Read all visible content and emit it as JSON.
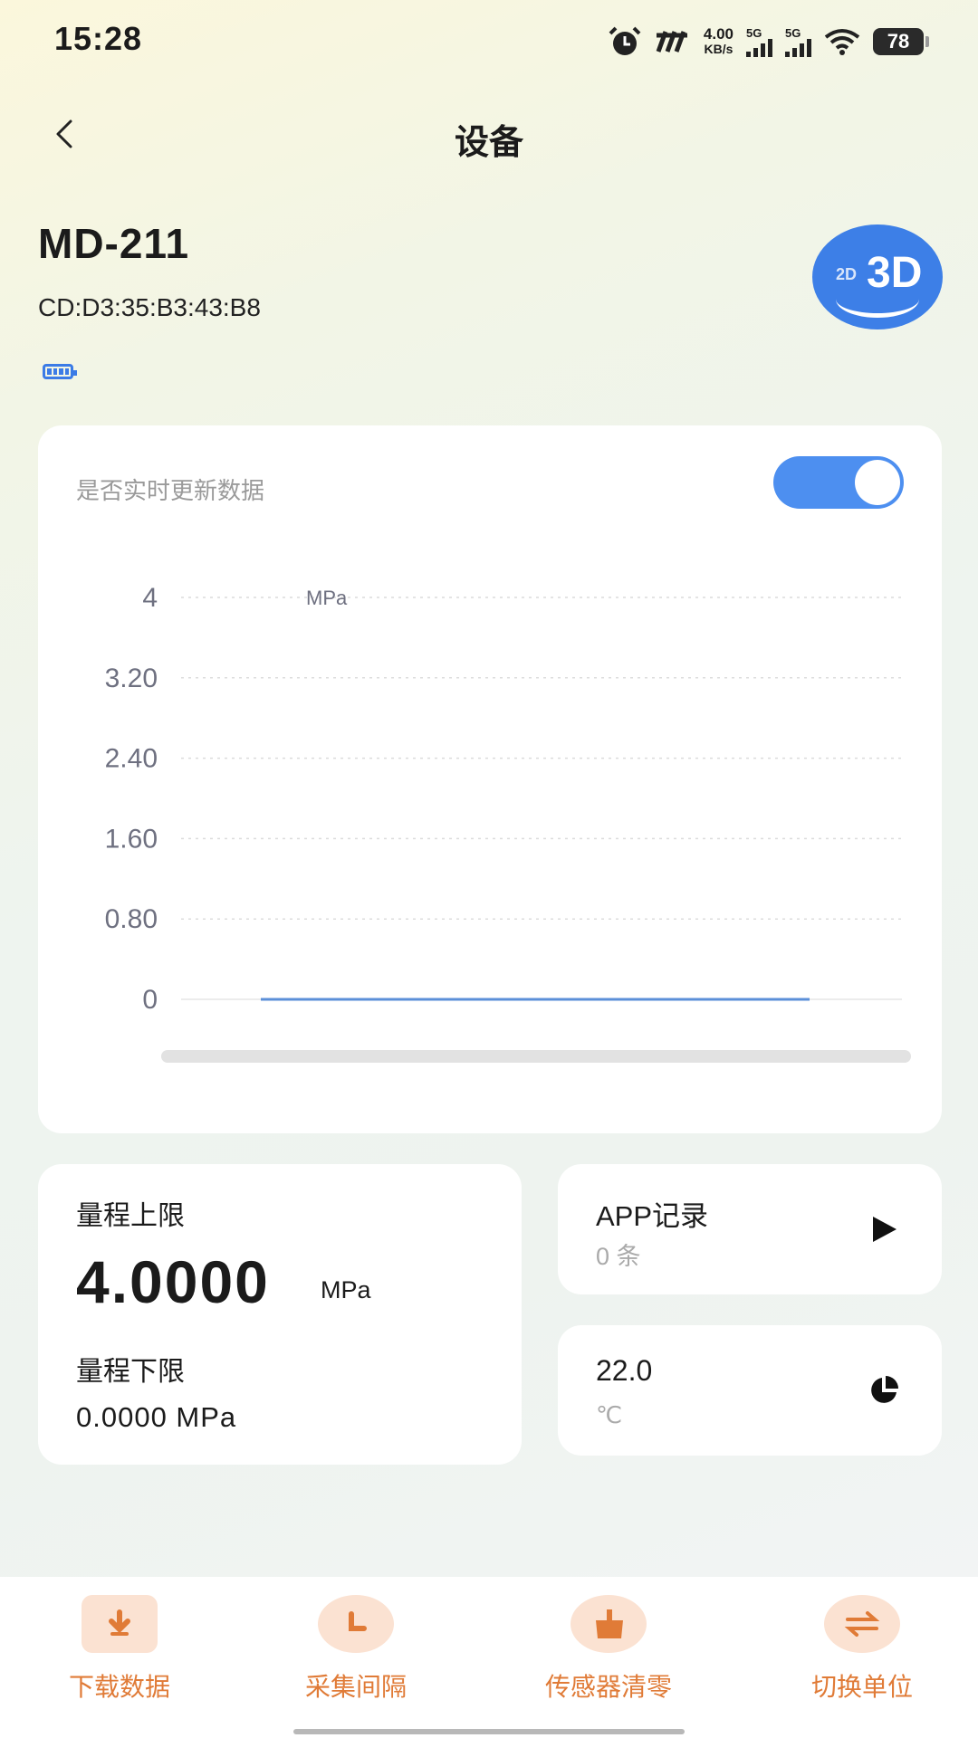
{
  "status_bar": {
    "time": "15:28",
    "speed_value": "4.00",
    "speed_unit": "KB/s",
    "sim1": "5G",
    "sim2": "5G",
    "battery": "78"
  },
  "header": {
    "title": "设备"
  },
  "device": {
    "name": "MD-211",
    "mac": "CD:D3:35:B3:43:B8",
    "view_toggle_2d": "2D",
    "view_toggle_3d": "3D"
  },
  "realtime": {
    "label": "是否实时更新数据",
    "enabled": true
  },
  "chart_data": {
    "type": "line",
    "unit_label": "MPa",
    "y_ticks": [
      "4",
      "3.20",
      "2.40",
      "1.60",
      "0.80",
      "0"
    ],
    "ylim": [
      0,
      4
    ],
    "grid": true,
    "series": [
      {
        "values": [
          0,
          0
        ]
      }
    ]
  },
  "range": {
    "upper_label": "量程上限",
    "upper_value": "4.0000",
    "upper_unit": "MPa",
    "lower_label": "量程下限",
    "lower_value": "0.0000 MPa"
  },
  "app_record": {
    "title": "APP记录",
    "count": "0 条"
  },
  "temperature": {
    "value": "22.0",
    "unit": "℃"
  },
  "bottom_nav": [
    {
      "label": "下载数据",
      "icon": "download-icon"
    },
    {
      "label": "采集间隔",
      "icon": "clock-icon"
    },
    {
      "label": "传感器清零",
      "icon": "broom-icon"
    },
    {
      "label": "切换单位",
      "icon": "swap-icon"
    }
  ],
  "colors": {
    "accent": "#4d8ff0",
    "nav": "#e07b37",
    "nav_bg": "#fbe6d8",
    "line": "#5b8fd8"
  }
}
